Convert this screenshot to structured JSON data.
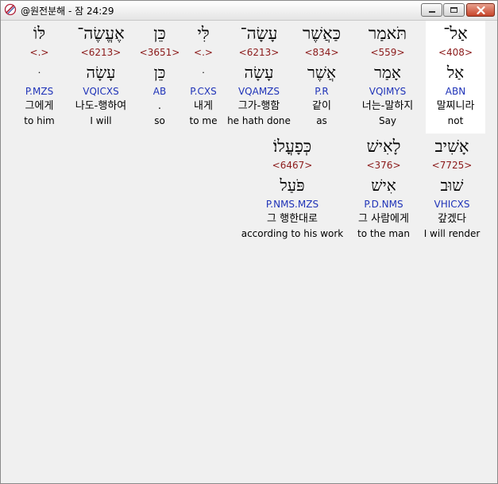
{
  "window": {
    "title": "@원전분해 - 잠 24:29",
    "icon": "app-icon",
    "buttons": [
      "minimize-icon",
      "maximize-icon",
      "close-icon"
    ],
    "colors": {
      "strong_number": "#8b1a1a",
      "morphology": "#1f33b8",
      "highlight": "#ffffff",
      "background": "#f0f0f0"
    }
  },
  "rows": [
    {
      "words": [
        {
          "hebrew": "אַל־",
          "strong": "<408>",
          "lemma": "אַל",
          "morph": "ABN",
          "korean": "말찌니라",
          "english": "not",
          "highlighted": true
        },
        {
          "hebrew": "תֹּאמַר",
          "strong": "<559>",
          "lemma": "אָמַר",
          "morph": "VQIMYS",
          "korean": "너는-말하지",
          "english": "Say",
          "highlighted": false
        },
        {
          "hebrew": "כַּאֲשֶׁר",
          "strong": "<834>",
          "lemma": "אֲשֶׁר",
          "morph": "P.R",
          "korean": "같이",
          "english": "as",
          "highlighted": false
        },
        {
          "hebrew": "עָשָׂה־",
          "strong": "<6213>",
          "lemma": "עָשָׂה",
          "morph": "VQAMZS",
          "korean": "그가-행함",
          "english": "he hath done",
          "highlighted": false
        },
        {
          "hebrew": "לִּי",
          "strong": "<.>",
          "lemma": "ּ",
          "morph": "P.CXS",
          "korean": "내게",
          "english": "to me",
          "highlighted": false
        },
        {
          "hebrew": "כֵּן",
          "strong": "<3651>",
          "lemma": "כֵּן",
          "morph": "AB",
          "korean": ".",
          "english": "so",
          "highlighted": false
        },
        {
          "hebrew": "אֶעֱשֶׂה־",
          "strong": "<6213>",
          "lemma": "עָשָׂה",
          "morph": "VQICXS",
          "korean": "나도-행하여",
          "english": "I will",
          "highlighted": false
        },
        {
          "hebrew": "לּוֹ",
          "strong": "<.>",
          "lemma": "ּ",
          "morph": "P.MZS",
          "korean": "그에게",
          "english": "to him",
          "highlighted": false
        }
      ]
    },
    {
      "words": [
        {
          "hebrew": "אָשִׁיב",
          "strong": "<7725>",
          "lemma": "שׁוּב",
          "morph": "VHICXS",
          "korean": "갚겠다",
          "english": "I will render",
          "highlighted": false
        },
        {
          "hebrew": "לָאִישׁ",
          "strong": "<376>",
          "lemma": "אִישׁ",
          "morph": "P.D.NMS",
          "korean": "그 사람에게",
          "english": "to the man",
          "highlighted": false
        },
        {
          "hebrew": "כְּפָעֳלוֹ׃",
          "strong": "<6467>",
          "lemma": "פֹּעַל",
          "morph": "P.NMS.MZS",
          "korean": "그 행한대로",
          "english": "according to his work",
          "highlighted": false
        }
      ]
    }
  ]
}
